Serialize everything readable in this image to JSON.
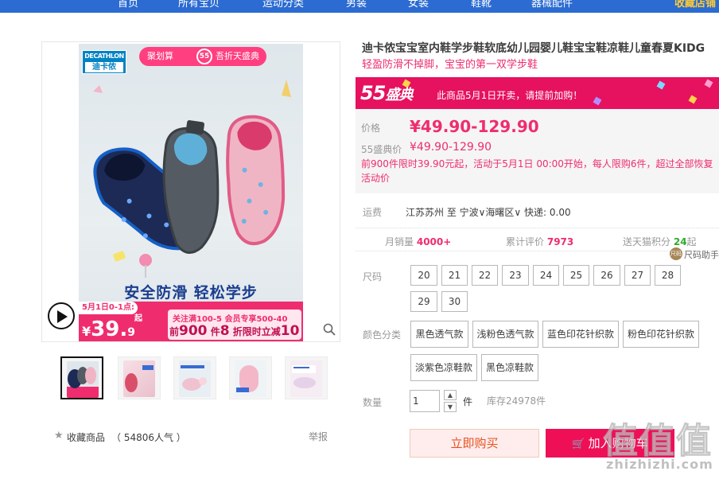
{
  "nav": {
    "items": [
      "首页",
      "所有宝贝",
      "运动分类",
      "男装",
      "女装",
      "鞋靴",
      "器械配件"
    ],
    "favorite_shop": "收藏店铺"
  },
  "gallery": {
    "main_image": {
      "brand_en": "DECATHLON",
      "brand_zh": "迪卡侬",
      "promo_left": "聚划算",
      "promo_badge": "55",
      "promo_right": "吾折天盛典",
      "slogan": "安全防滑 轻松学步",
      "date_badge": "5月1日0-1点:",
      "qi": "起",
      "price_yen": "¥",
      "price_int": "39.",
      "price_dec": "9",
      "promo2_line1": "关注满100-5 会员专享500-40",
      "promo2_line2_a": "前",
      "promo2_line2_b": "900",
      "promo2_line2_c": " 件",
      "promo2_line2_d": "8",
      "promo2_line2_e": " 折限时立减",
      "promo2_line2_f": "10"
    },
    "thumbnails": [
      "thumb-1",
      "thumb-2",
      "thumb-3",
      "thumb-4",
      "thumb-5"
    ],
    "favorite_label": "收藏商品",
    "popularity": "（ 54806人气 ）",
    "report_label": "举报"
  },
  "product": {
    "title": "迪卡侬宝宝室内鞋学步鞋软底幼儿园婴儿鞋宝宝鞋凉鞋儿童春夏KIDG",
    "subtitle": "轻盈防滑不掉脚，宝宝的第一双学步鞋"
  },
  "promo_band": {
    "logo_num": "55",
    "logo_text": "盛典",
    "text": "此商品5月1日开卖，请提前加购！"
  },
  "price": {
    "label": "价格",
    "value": "¥49.90-129.90",
    "event_label": "55盛典价",
    "event_value": "¥49.90-129.90",
    "note": "前900件限时39.90元起，活动于5月1日 00:00开始，每人限购6件，超过全部恢复活动价"
  },
  "shipping": {
    "label": "运费",
    "route": "江苏苏州 至 宁波∨海曙区∨ 快递: 0.00"
  },
  "stats": {
    "monthly_sales_label": "月销量",
    "monthly_sales_value": "4000+",
    "reviews_label": "累计评价",
    "reviews_value": "7973",
    "points_label": "送天猫积分",
    "points_value": "24",
    "points_suffix": "起"
  },
  "size_assistant": {
    "icon": "尺码",
    "label": "尺码助手"
  },
  "sizes": {
    "label": "尺码",
    "options": [
      "20",
      "21",
      "22",
      "23",
      "24",
      "25",
      "26",
      "27",
      "28",
      "29",
      "30"
    ]
  },
  "colors": {
    "label": "颜色分类",
    "options": [
      "黑色透气款",
      "浅粉色透气款",
      "蓝色印花针织款",
      "粉色印花针织款",
      "淡紫色凉鞋款",
      "黑色凉鞋款"
    ]
  },
  "quantity": {
    "label": "数量",
    "value": "1",
    "unit": "件",
    "stock": "库存24978件",
    "up_icon": "▲",
    "down_icon": "▼"
  },
  "actions": {
    "buy_now": "立即购买",
    "add_cart_icon": "🛒",
    "add_cart": "加入购物车"
  },
  "watermark": {
    "text": "值值值",
    "url": "zhizhizhi.com"
  }
}
